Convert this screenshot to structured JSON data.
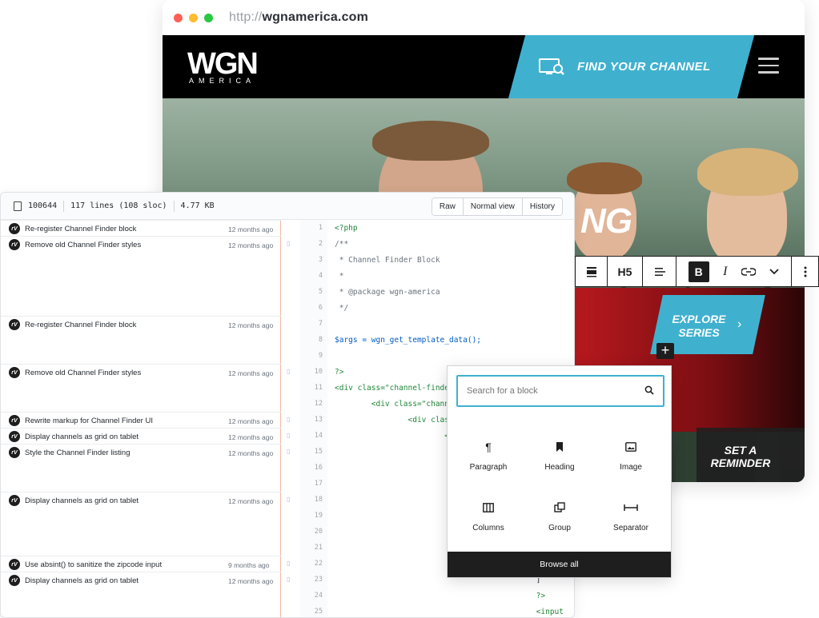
{
  "browser": {
    "url_prefix": "http://",
    "url_domain": "wgnamerica.com",
    "traffic_lights": [
      "#ff5f57",
      "#febc2e",
      "#28c840"
    ]
  },
  "site": {
    "logo_main": "WGN",
    "logo_sub": "AMERICA",
    "find_channel_label": "FIND YOUR CHANNEL",
    "accent_color": "#3fb1cf",
    "explore_label_line1": "EXPLORE",
    "explore_label_line2": "SERIES",
    "brand_fragment": "NG",
    "reminder_line1": "SET A",
    "reminder_line2": "REMINDER"
  },
  "block_toolbar": {
    "heading_level": "H5",
    "bold": "B",
    "italic": "I"
  },
  "file_header": {
    "mode": "100644",
    "lines": "117 lines (108 sloc)",
    "size": "4.77 KB",
    "buttons": [
      "Raw",
      "Normal view",
      "History"
    ]
  },
  "blame": [
    {
      "message": "Re-register Channel Finder block",
      "time": "12 months ago",
      "avatar": "rV"
    },
    {
      "message": "Remove old Channel Finder styles",
      "time": "12 months ago",
      "avatar": "rV"
    },
    {
      "message": "Re-register Channel Finder block",
      "time": "12 months ago",
      "avatar": "rV"
    },
    {
      "message": "Remove old Channel Finder styles",
      "time": "12 months ago",
      "avatar": "rV"
    },
    {
      "message": "Rewrite markup for Channel Finder UI",
      "time": "12 months ago",
      "avatar": "rV"
    },
    {
      "message": "Display channels as grid on tablet",
      "time": "12 months ago",
      "avatar": "rV"
    },
    {
      "message": "Style the Channel Finder listing",
      "time": "12 months ago",
      "avatar": "rV"
    },
    {
      "message": "Display channels as grid on tablet",
      "time": "12 months ago",
      "avatar": "rV"
    },
    {
      "message": "Use absint() to sanitize the zipcode input",
      "time": "9 months ago",
      "avatar": "rV"
    },
    {
      "message": "Display channels as grid on tablet",
      "time": "12 months ago",
      "avatar": "rV"
    }
  ],
  "code": [
    {
      "n": "1",
      "t": "<?php"
    },
    {
      "n": "2",
      "t": "/**"
    },
    {
      "n": "3",
      "t": " * Channel Finder Block"
    },
    {
      "n": "4",
      "t": " *"
    },
    {
      "n": "5",
      "t": " * @package wgn-america"
    },
    {
      "n": "6",
      "t": " */"
    },
    {
      "n": "7",
      "t": ""
    },
    {
      "n": "8",
      "t": "$args = wgn_get_template_data();"
    },
    {
      "n": "9",
      "t": ""
    },
    {
      "n": "10",
      "t": "?>"
    },
    {
      "n": "11",
      "t": "<div class=\"channel-finder"
    },
    {
      "n": "12",
      "t": "        <div class=\"channe"
    },
    {
      "n": "13",
      "t": "                <div clas"
    },
    {
      "n": "14",
      "t": "                        <d"
    },
    {
      "n": "15",
      "t": ""
    },
    {
      "n": "16",
      "t": ""
    },
    {
      "n": "17",
      "t": ""
    },
    {
      "n": "18",
      "t": ""
    },
    {
      "n": "19",
      "t": ""
    },
    {
      "n": "20",
      "t": ""
    },
    {
      "n": "21",
      "t": ""
    },
    {
      "n": "22",
      "t": ""
    },
    {
      "n": "23",
      "t": "                                            ]"
    },
    {
      "n": "24",
      "t": "                                            ?>"
    },
    {
      "n": "25",
      "t": "                                            <input"
    }
  ],
  "inserter": {
    "search_placeholder": "Search for a block",
    "blocks": [
      "Paragraph",
      "Heading",
      "Image",
      "Columns",
      "Group",
      "Separator"
    ],
    "icons": [
      "¶",
      "▮",
      "▣",
      "▥",
      "⧉",
      "⊢⊣"
    ],
    "browse_all": "Browse all"
  }
}
